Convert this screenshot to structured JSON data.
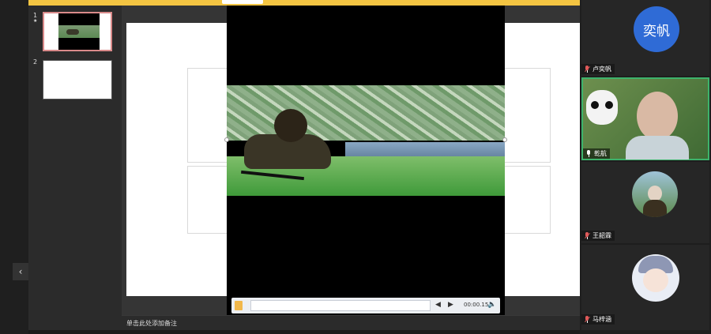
{
  "top_notice": {
    "text": ""
  },
  "thumbnails": [
    {
      "number": "1",
      "active": true
    },
    {
      "number": "2",
      "active": false
    }
  ],
  "video": {
    "time": "00:00.15",
    "back_icon": "step-back-icon",
    "forward_icon": "step-forward-icon",
    "volume_icon": "volume-icon"
  },
  "notes": {
    "placeholder": "单击此处添加备注"
  },
  "participants": [
    {
      "name": "卢奕帆",
      "avatar_text": "奕帆",
      "mic": "off",
      "avatar_color": "#2f6bd6"
    },
    {
      "name": "乾航",
      "mic": "on",
      "speaking": true
    },
    {
      "name": "王韶霖",
      "mic": "off"
    },
    {
      "name": "马梓涵",
      "mic": "off"
    }
  ],
  "colors": {
    "accent_bar": "#f4c542",
    "active_border": "#3db36b"
  }
}
